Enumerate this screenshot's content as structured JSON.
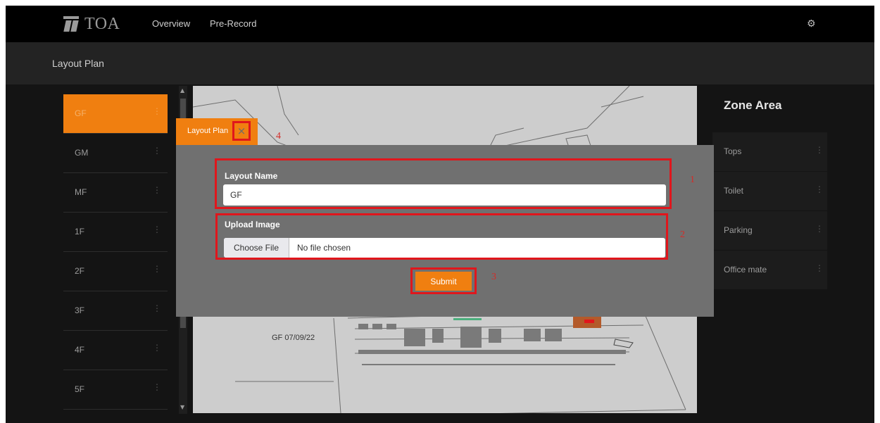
{
  "brand": {
    "name": "TOA"
  },
  "nav": {
    "links": [
      "Overview",
      "Pre-Record"
    ]
  },
  "page": {
    "title": "Layout Plan"
  },
  "floors": [
    {
      "label": "GF",
      "active": true
    },
    {
      "label": "GM",
      "active": false
    },
    {
      "label": "MF",
      "active": false
    },
    {
      "label": "1F",
      "active": false
    },
    {
      "label": "2F",
      "active": false
    },
    {
      "label": "3F",
      "active": false
    },
    {
      "label": "4F",
      "active": false
    },
    {
      "label": "5F",
      "active": false
    }
  ],
  "plan": {
    "caption": "GF 07/09/22"
  },
  "zone": {
    "title": "Zone Area",
    "items": [
      "Tops",
      "Toilet",
      "Parking",
      "Office mate"
    ]
  },
  "modal": {
    "tab_label": "Layout Plan",
    "close_symbol": "×",
    "layout_name_label": "Layout Name",
    "layout_name_value": "GF",
    "upload_label": "Upload Image",
    "choose_file_label": "Choose File",
    "file_status": "No file chosen",
    "submit_label": "Submit"
  },
  "annotations": [
    "1",
    "2",
    "3",
    "4"
  ],
  "colors": {
    "accent": "#f07f10",
    "highlight_red": "#e0161c",
    "topbar": "#000000",
    "background_dark": "#141414"
  },
  "icons": {
    "settings": "gear-icon",
    "close": "close-icon",
    "kebab": "kebab-icon"
  }
}
